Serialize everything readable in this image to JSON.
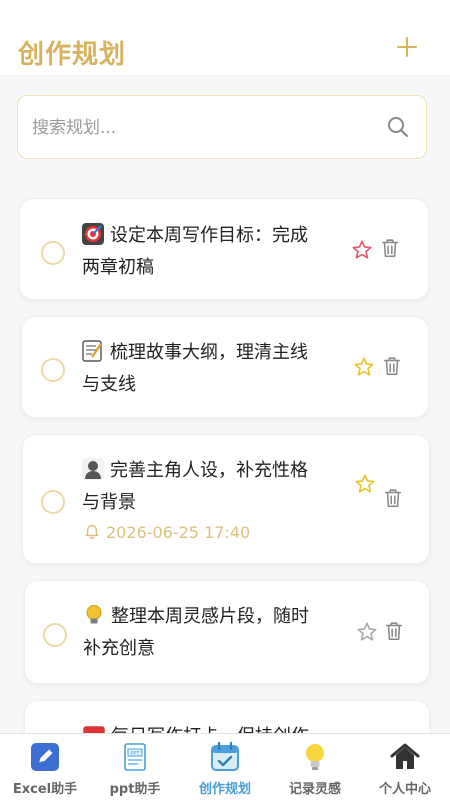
{
  "header": {
    "title": "创作规划",
    "add_icon": "plus-icon",
    "accent": "#d9b25e"
  },
  "search": {
    "placeholder": "搜索规划...",
    "value": "",
    "icon": "search-icon"
  },
  "tasks": [
    {
      "emoji": "target-emoji",
      "text1": "设定本周写作目标：完成",
      "text2": "两章初稿",
      "starred": true,
      "star_color": "#e05a6a",
      "reminder": ""
    },
    {
      "emoji": "memo-emoji",
      "text1": "梳理故事大纲，理清主线",
      "text2": "与支线",
      "starred": true,
      "star_color": "#e8c32a",
      "reminder": ""
    },
    {
      "emoji": "person-emoji",
      "text1": "完善主角人设，补充性格",
      "text2": "与背景",
      "starred": true,
      "star_color": "#e8c32a",
      "reminder": "2026-06-25 17:40"
    },
    {
      "emoji": "bulb-emoji",
      "text1": "整理本周灵感片段，随时",
      "text2": "补充创意",
      "starred": false,
      "star_color": "#aaaaaa",
      "reminder": ""
    },
    {
      "emoji": "calendar-emoji",
      "text1": "每日写作打卡，保持创作",
      "text2": "",
      "starred": false,
      "star_color": "#aaaaaa",
      "reminder": ""
    }
  ],
  "tabbar": {
    "tabs": [
      {
        "label": "Excel助手",
        "icon": "pen-icon"
      },
      {
        "label": "ppt助手",
        "icon": "ppt-icon"
      },
      {
        "label": "创作规划",
        "icon": "calendar-icon",
        "active": true
      },
      {
        "label": "记录灵感",
        "icon": "bulb-icon"
      },
      {
        "label": "个人中心",
        "icon": "home-icon"
      }
    ],
    "active_color": "#4a9fd8"
  }
}
